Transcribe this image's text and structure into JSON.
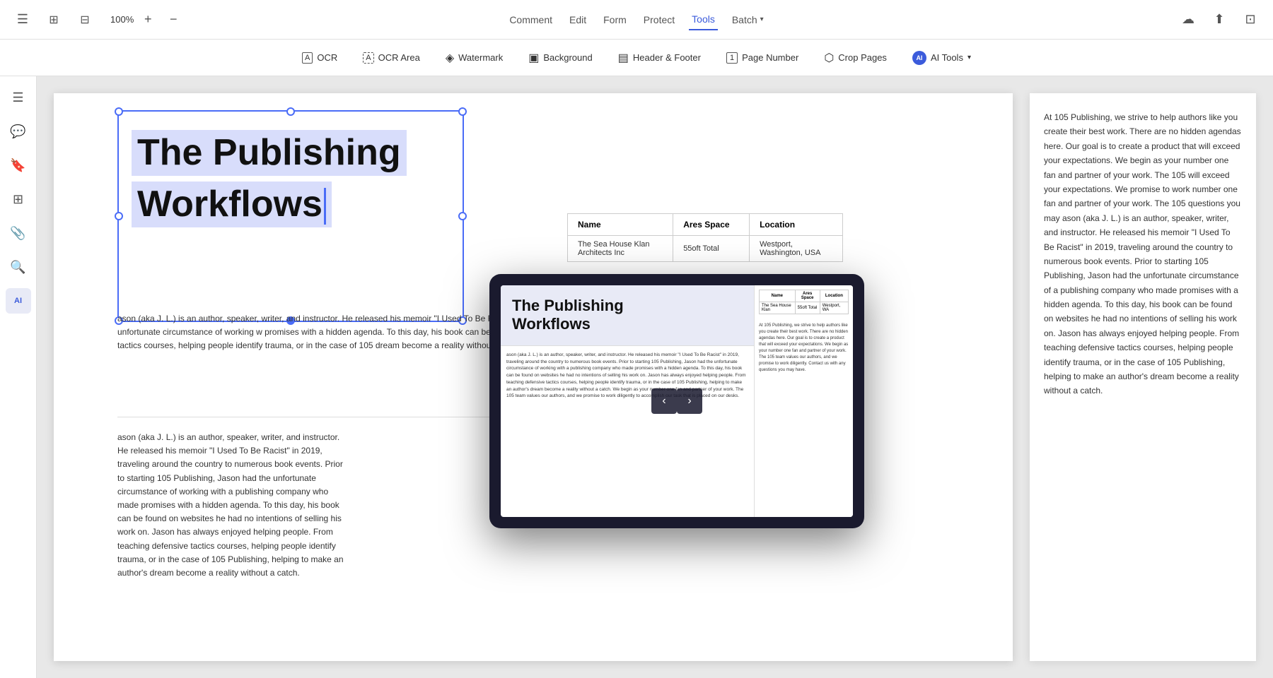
{
  "topToolbar": {
    "viewToggle": [
      "grid-view",
      "split-view"
    ],
    "zoom": "100%",
    "zoomIn": "+",
    "zoomOut": "−",
    "navItems": [
      {
        "id": "comment",
        "label": "Comment",
        "active": false
      },
      {
        "id": "edit",
        "label": "Edit",
        "active": false
      },
      {
        "id": "form",
        "label": "Form",
        "active": false
      },
      {
        "id": "protect",
        "label": "Protect",
        "active": false
      },
      {
        "id": "tools",
        "label": "Tools",
        "active": true
      },
      {
        "id": "batch",
        "label": "Batch",
        "active": false,
        "hasArrow": true
      }
    ],
    "rightIcons": [
      "upload-cloud",
      "share",
      "expand"
    ]
  },
  "secondToolbar": {
    "items": [
      {
        "id": "ocr",
        "label": "OCR",
        "icon": "⬚"
      },
      {
        "id": "ocr-area",
        "label": "OCR Area",
        "icon": "⬜"
      },
      {
        "id": "watermark",
        "label": "Watermark",
        "icon": "◈"
      },
      {
        "id": "background",
        "label": "Background",
        "icon": "▣"
      },
      {
        "id": "header-footer",
        "label": "Header & Footer",
        "icon": "▤"
      },
      {
        "id": "page-number",
        "label": "Page Number",
        "icon": "①"
      },
      {
        "id": "crop-pages",
        "label": "Crop Pages",
        "icon": "⬡"
      },
      {
        "id": "ai-tools",
        "label": "AI Tools",
        "icon": "AI",
        "hasArrow": true
      }
    ]
  },
  "sidebar": {
    "items": [
      {
        "id": "panel",
        "icon": "▣",
        "active": false
      },
      {
        "id": "comment",
        "icon": "💬",
        "active": false
      },
      {
        "id": "bookmark",
        "icon": "🔖",
        "active": false
      },
      {
        "id": "layers",
        "icon": "⊞",
        "active": false
      },
      {
        "id": "attachment",
        "icon": "📎",
        "active": false
      },
      {
        "id": "search",
        "icon": "🔍",
        "active": false
      },
      {
        "id": "ai",
        "icon": "AI",
        "active": true
      }
    ]
  },
  "document": {
    "title": {
      "line1": "The Publishing",
      "line2": "Workflows"
    },
    "table": {
      "headers": [
        "Name",
        "Ares Space",
        "Location"
      ],
      "rows": [
        [
          "The Sea House Klan\nArchitects Inc",
          "55oft Total",
          "Westport,\nWashington, USA"
        ]
      ]
    },
    "bodyText": "ason (aka J. L.) is an author, speaker, writer, and instructor. He released his memoir \"I Used To Be Racist\" in 201 numerous book events. Prior to starting 105 Publishing, Jason had the unfortunate circumstance of working w promises with a hidden agenda. To this day, his book can be found on websites he had no intentions of selling helping people. From teaching defensive tactics courses, helping people identify trauma, or in the case of 105 dream become a reality without a catch.",
    "bodyText2": "ason (aka J. L.) is an author, speaker, writer, and instructor. He released his memoir \"I Used To Be Racist\" in 2019, traveling around the country to numerous book events. Prior to starting 105 Publishing, Jason had the unfortunate circumstance of working with a publishing company who made promises with a hidden agenda. To this day, his book can be found on websites he had no intentions of selling his work on. Jason has always enjoyed helping people. From teaching defensive tactics courses, helping people identify trauma, or in the case of 105 Publishing, helping to make an author's dream become a reality without a catch."
  },
  "rightPanel": {
    "text": "At 105 Publishing, we strive to help authors like you create their best work. There are no hidden agendas here. Our goal is to create a product that will exceed your expectations. We begin as your number one fan and partner of your work. The 105 will exceed your expectations. We promise to work number one fan and partner of your work. The 105 questions you may\n\nason (aka J. L.) is an author, speaker, writer, and instructor. He released his memoir \"I Used To Be Racist\" in 2019, traveling around the country to numerous book events. Prior to starting 105 Publishing, Jason had the unfortunate circumstance of a publishing company who made promises with a hidden agenda. To this day, his book can be found on websites he had no intentions of selling his work on. Jason has always enjoyed helping people. From teaching defensive tactics courses, helping people identify trauma, or in the case of 105 Publishing, helping to make an author's dream become a reality without a catch."
  },
  "preview": {
    "title": "The Publishing\nWorkflows",
    "navLeft": "‹",
    "navRight": "›",
    "tableHeaders": [
      "Name",
      "Ares Space",
      "Location"
    ],
    "tableRows": [
      [
        "The Sea House Klan",
        "55oft Total",
        "Westport, WA"
      ]
    ],
    "bodyPreview": "ason (aka J. L.) is an author, speaker, writer, and instructor. He released his memoir \"I Used To Be Racist\" in 2019, traveling around the country to numerous book events. Prior to starting 105 Publishing, Jason had the unfortunate circumstance of working with a publishing company who made promises with a hidden agenda. To this day, his book can be found on websites he had no intentions of selling his work on. Jason has always enjoyed helping people. From teaching defensive tactics courses, helping people identify trauma, or in the case of 105 Publishing, helping to make an author's dream become a reality without a catch.\n\nWe begin as your number one fan and partner of your work. The 105 team values our authors, and we promise to work diligently to accomplish our task that is placed on our desks."
  }
}
